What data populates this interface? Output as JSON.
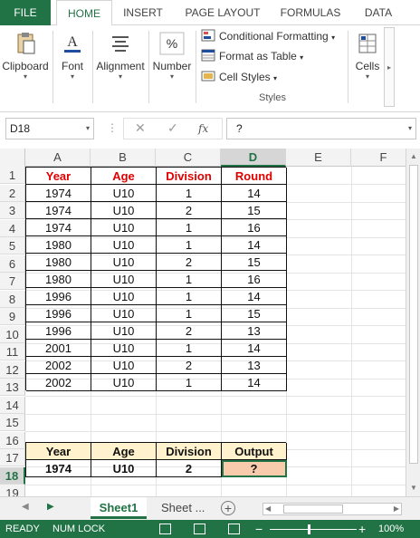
{
  "ribbon_tabs": {
    "file": "FILE",
    "home": "HOME",
    "insert": "INSERT",
    "page_layout": "PAGE LAYOUT",
    "formulas": "FORMULAS",
    "data": "DATA"
  },
  "ribbon": {
    "clipboard": "Clipboard",
    "font": "Font",
    "alignment": "Alignment",
    "number": "Number",
    "conditional_formatting": "Conditional Formatting",
    "format_as_table": "Format as Table",
    "cell_styles": "Cell Styles",
    "styles_group": "Styles",
    "cells": "Cells",
    "dropdown_glyph": "▾"
  },
  "formula_bar": {
    "name_box": "D18",
    "cancel": "✕",
    "enter": "✓",
    "fx": "fx",
    "content": "?"
  },
  "columns": [
    "A",
    "B",
    "C",
    "D",
    "E",
    "F"
  ],
  "rows": [
    "1",
    "2",
    "3",
    "4",
    "5",
    "6",
    "7",
    "8",
    "9",
    "10",
    "11",
    "12",
    "13",
    "14",
    "15",
    "16",
    "17",
    "18",
    "19"
  ],
  "table": {
    "headers": [
      "Year",
      "Age",
      "Division",
      "Round"
    ],
    "rows": [
      [
        "1974",
        "U10",
        "1",
        "14"
      ],
      [
        "1974",
        "U10",
        "2",
        "15"
      ],
      [
        "1974",
        "U10",
        "1",
        "16"
      ],
      [
        "1980",
        "U10",
        "1",
        "14"
      ],
      [
        "1980",
        "U10",
        "2",
        "15"
      ],
      [
        "1980",
        "U10",
        "1",
        "16"
      ],
      [
        "1996",
        "U10",
        "1",
        "14"
      ],
      [
        "1996",
        "U10",
        "1",
        "15"
      ],
      [
        "1996",
        "U10",
        "2",
        "13"
      ],
      [
        "2001",
        "U10",
        "1",
        "14"
      ],
      [
        "2002",
        "U10",
        "2",
        "13"
      ],
      [
        "2002",
        "U10",
        "1",
        "14"
      ]
    ]
  },
  "lookup": {
    "headers": [
      "Year",
      "Age",
      "Division",
      "Output"
    ],
    "values": [
      "1974",
      "U10",
      "2",
      "?"
    ]
  },
  "sheets": {
    "active": "Sheet1",
    "other": "Sheet ...",
    "add": "+"
  },
  "status": {
    "ready": "READY",
    "num_lock": "NUM LOCK",
    "zoom_minus": "−",
    "zoom_plus": "+",
    "zoom": "100%"
  },
  "colors": {
    "accent": "#217346",
    "header_red": "#e00000",
    "yellow_fill": "#fff2cc",
    "output_fill": "#f8cbad"
  }
}
